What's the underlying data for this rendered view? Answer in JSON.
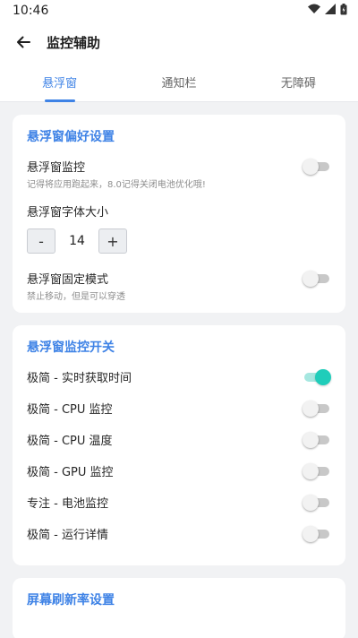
{
  "status_bar": {
    "time": "10:46",
    "icons": [
      "wifi-icon",
      "signal-icon",
      "battery-icon"
    ]
  },
  "app_bar": {
    "back_icon": "arrow-left-icon",
    "title": "监控辅助"
  },
  "tabs": [
    {
      "label": "悬浮窗",
      "active": true
    },
    {
      "label": "通知栏",
      "active": false
    },
    {
      "label": "无障碍",
      "active": false
    }
  ],
  "card_float_prefs": {
    "title": "悬浮窗偏好设置",
    "monitor": {
      "label": "悬浮窗监控",
      "desc": "记得将应用跑起来，8.0记得关闭电池优化哦!",
      "on": false
    },
    "font_size": {
      "label": "悬浮窗字体大小",
      "minus_label": "-",
      "value": "14",
      "plus_label": "+"
    },
    "fixed_mode": {
      "label": "悬浮窗固定模式",
      "desc": "禁止移动，但是可以穿透",
      "on": false
    }
  },
  "card_monitor_switches": {
    "title": "悬浮窗监控开关",
    "items": [
      {
        "label": "极简 - 实时获取时间",
        "on": true
      },
      {
        "label": "极简 - CPU 监控",
        "on": false
      },
      {
        "label": "极简 - CPU 温度",
        "on": false
      },
      {
        "label": "极简 - GPU 监控",
        "on": false
      },
      {
        "label": "专注 - 电池监控",
        "on": false
      },
      {
        "label": "极简 - 运行详情",
        "on": false
      }
    ]
  },
  "card_refresh": {
    "title": "屏幕刷新率设置"
  },
  "colors": {
    "accent": "#3f83e6",
    "switch_on": "#1fcdba",
    "switch_off": "#c8c8c8"
  }
}
